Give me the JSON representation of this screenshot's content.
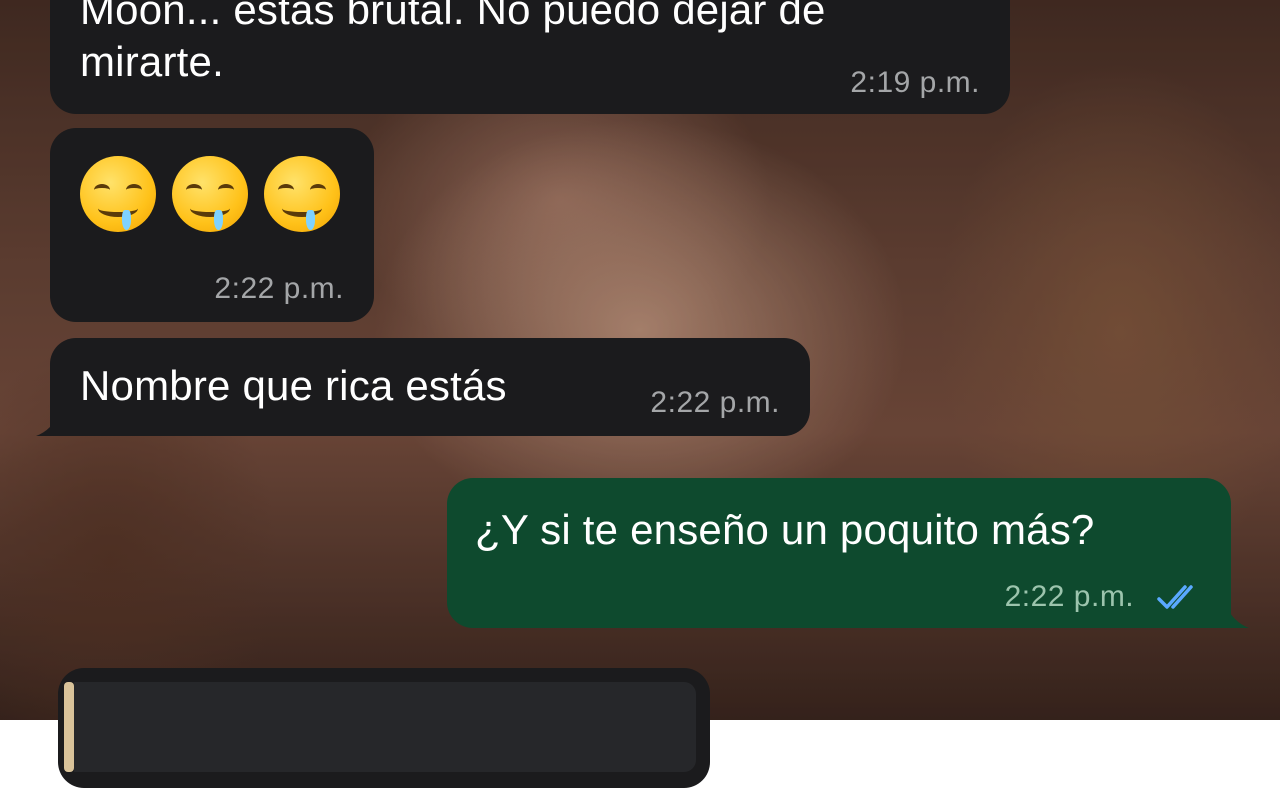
{
  "messages": [
    {
      "id": "m1",
      "line1": "Moon... estás brutal. No puedo dejar de",
      "line2": "mirarte.",
      "time": "2:19 p.m."
    },
    {
      "id": "m2",
      "emoji": [
        "drooling-face",
        "drooling-face",
        "drooling-face"
      ],
      "time": "2:22 p.m."
    },
    {
      "id": "m3",
      "text": "Nombre que rica estás",
      "time": "2:22 p.m."
    },
    {
      "id": "m4",
      "text": "¿Y si te enseño un poquito más?",
      "time": "2:22 p.m.",
      "status_icon": "double-check-read-icon"
    }
  ],
  "colors": {
    "incoming_bubble": "#1b1b1d",
    "outgoing_bubble": "#0e4a2e",
    "read_ticks": "#5aa9ff"
  }
}
